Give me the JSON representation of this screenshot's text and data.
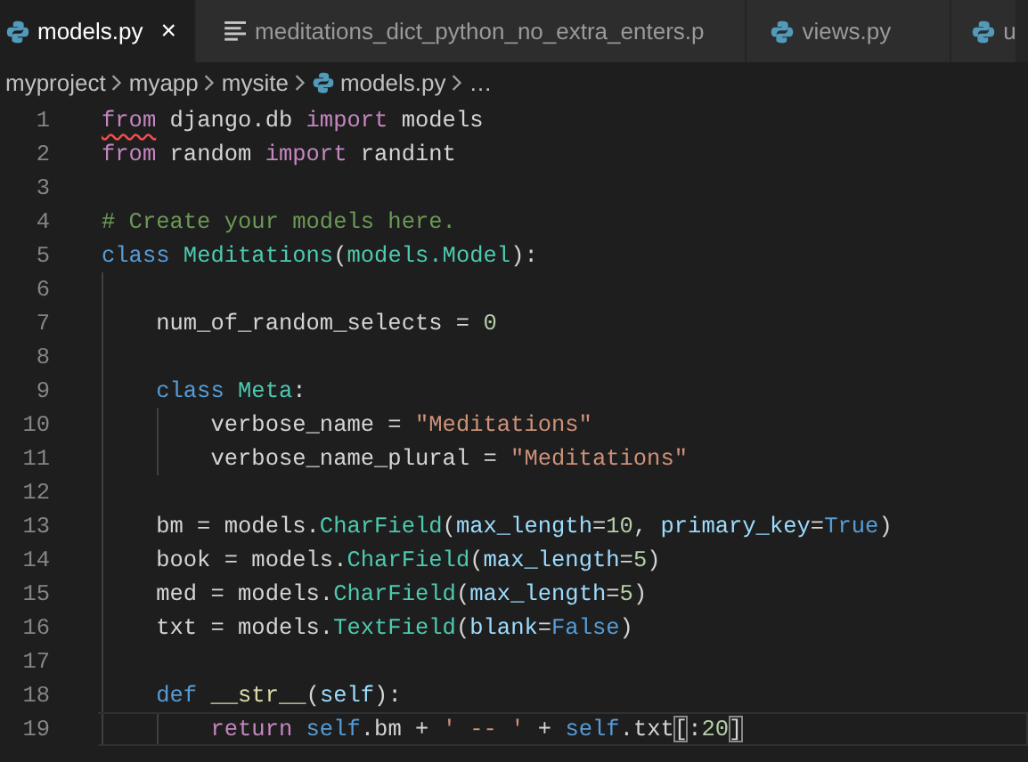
{
  "tabs": [
    {
      "label": "models.py",
      "kind": "python-file",
      "selected": true,
      "close": "×"
    },
    {
      "label": "meditations_dict_python_no_extra_enters.p",
      "kind": "text-file",
      "selected": false
    },
    {
      "label": "views.py",
      "kind": "python-file",
      "selected": false
    },
    {
      "label": "u",
      "kind": "python-file",
      "selected": false
    }
  ],
  "breadcrumbs": [
    {
      "label": "myproject",
      "kind": "folder"
    },
    {
      "label": "myapp",
      "kind": "folder"
    },
    {
      "label": "mysite",
      "kind": "folder"
    },
    {
      "label": "models.py",
      "kind": "python-file"
    },
    {
      "label": "…",
      "kind": "more"
    }
  ],
  "lines": [
    {
      "number": "1",
      "current": false,
      "tokens": [
        {
          "kind": "keyword",
          "text": "from",
          "error": true
        },
        {
          "kind": "plain",
          "text": " django.db "
        },
        {
          "kind": "keyword",
          "text": "import"
        },
        {
          "kind": "plain",
          "text": " models"
        }
      ]
    },
    {
      "number": "2",
      "current": false,
      "tokens": [
        {
          "kind": "keyword",
          "text": "from"
        },
        {
          "kind": "plain",
          "text": " random "
        },
        {
          "kind": "keyword",
          "text": "import"
        },
        {
          "kind": "plain",
          "text": " randint"
        }
      ]
    },
    {
      "number": "3",
      "current": false
    },
    {
      "number": "4",
      "current": false,
      "tokens": [
        {
          "kind": "comment",
          "text": "# Create your models here."
        }
      ]
    },
    {
      "number": "5",
      "current": false,
      "tokens": [
        {
          "kind": "storage",
          "text": "class"
        },
        {
          "kind": "type",
          "text": " Meditations"
        },
        {
          "kind": "plain",
          "text": "("
        },
        {
          "kind": "type",
          "text": "models.Model"
        },
        {
          "kind": "plain",
          "text": "):"
        }
      ]
    },
    {
      "number": "6",
      "current": false
    },
    {
      "number": "7",
      "current": false,
      "tokens": [
        {
          "kind": "plain",
          "text": "    num_of_random_selects = "
        },
        {
          "kind": "number",
          "text": "0"
        }
      ]
    },
    {
      "number": "8",
      "current": false
    },
    {
      "number": "9",
      "current": false,
      "tokens": [
        {
          "kind": "storage",
          "text": "    class"
        },
        {
          "kind": "type",
          "text": " Meta"
        },
        {
          "kind": "plain",
          "text": ":"
        }
      ]
    },
    {
      "number": "10",
      "current": false,
      "tokens": [
        {
          "kind": "plain",
          "text": "        verbose_name = "
        },
        {
          "kind": "string",
          "text": "\"Meditations\""
        }
      ]
    },
    {
      "number": "11",
      "current": false,
      "tokens": [
        {
          "kind": "plain",
          "text": "        verbose_name_plural = "
        },
        {
          "kind": "string",
          "text": "\"Meditations\""
        }
      ]
    },
    {
      "number": "12",
      "current": false
    },
    {
      "number": "13",
      "current": false,
      "tokens": [
        {
          "kind": "plain",
          "text": "    bm = models."
        },
        {
          "kind": "type",
          "text": "CharField"
        },
        {
          "kind": "plain",
          "text": "("
        },
        {
          "kind": "param",
          "text": "max_length"
        },
        {
          "kind": "plain",
          "text": "="
        },
        {
          "kind": "number",
          "text": "10"
        },
        {
          "kind": "plain",
          "text": ", "
        },
        {
          "kind": "param",
          "text": "primary_key"
        },
        {
          "kind": "plain",
          "text": "="
        },
        {
          "kind": "storage",
          "text": "True"
        },
        {
          "kind": "plain",
          "text": ")"
        }
      ]
    },
    {
      "number": "14",
      "current": false,
      "tokens": [
        {
          "kind": "plain",
          "text": "    book = models."
        },
        {
          "kind": "type",
          "text": "CharField"
        },
        {
          "kind": "plain",
          "text": "("
        },
        {
          "kind": "param",
          "text": "max_length"
        },
        {
          "kind": "plain",
          "text": "="
        },
        {
          "kind": "number",
          "text": "5"
        },
        {
          "kind": "plain",
          "text": ")"
        }
      ]
    },
    {
      "number": "15",
      "current": false,
      "tokens": [
        {
          "kind": "plain",
          "text": "    med = models."
        },
        {
          "kind": "type",
          "text": "CharField"
        },
        {
          "kind": "plain",
          "text": "("
        },
        {
          "kind": "param",
          "text": "max_length"
        },
        {
          "kind": "plain",
          "text": "="
        },
        {
          "kind": "number",
          "text": "5"
        },
        {
          "kind": "plain",
          "text": ")"
        }
      ]
    },
    {
      "number": "16",
      "current": false,
      "tokens": [
        {
          "kind": "plain",
          "text": "    txt = models."
        },
        {
          "kind": "type",
          "text": "TextField"
        },
        {
          "kind": "plain",
          "text": "("
        },
        {
          "kind": "param",
          "text": "blank"
        },
        {
          "kind": "plain",
          "text": "="
        },
        {
          "kind": "storage",
          "text": "False"
        },
        {
          "kind": "plain",
          "text": ")"
        }
      ]
    },
    {
      "number": "17",
      "current": false
    },
    {
      "number": "18",
      "current": false,
      "tokens": [
        {
          "kind": "storage",
          "text": "    def"
        },
        {
          "kind": "function",
          "text": " __str__"
        },
        {
          "kind": "plain",
          "text": "("
        },
        {
          "kind": "param",
          "text": "self"
        },
        {
          "kind": "plain",
          "text": "):"
        }
      ]
    },
    {
      "number": "19",
      "current": true,
      "tokens": [
        {
          "kind": "keyword",
          "text": "        return"
        },
        {
          "kind": "storage",
          "text": " self"
        },
        {
          "kind": "plain",
          "text": ".bm + "
        },
        {
          "kind": "string",
          "text": "' -- '"
        },
        {
          "kind": "plain",
          "text": " + "
        },
        {
          "kind": "storage",
          "text": "self"
        },
        {
          "kind": "plain",
          "text": ".txt"
        },
        {
          "kind": "bracket-match",
          "text": "["
        },
        {
          "kind": "plain",
          "text": ":"
        },
        {
          "kind": "number",
          "text": "20"
        },
        {
          "kind": "bracket-match",
          "text": "]"
        }
      ]
    }
  ]
}
